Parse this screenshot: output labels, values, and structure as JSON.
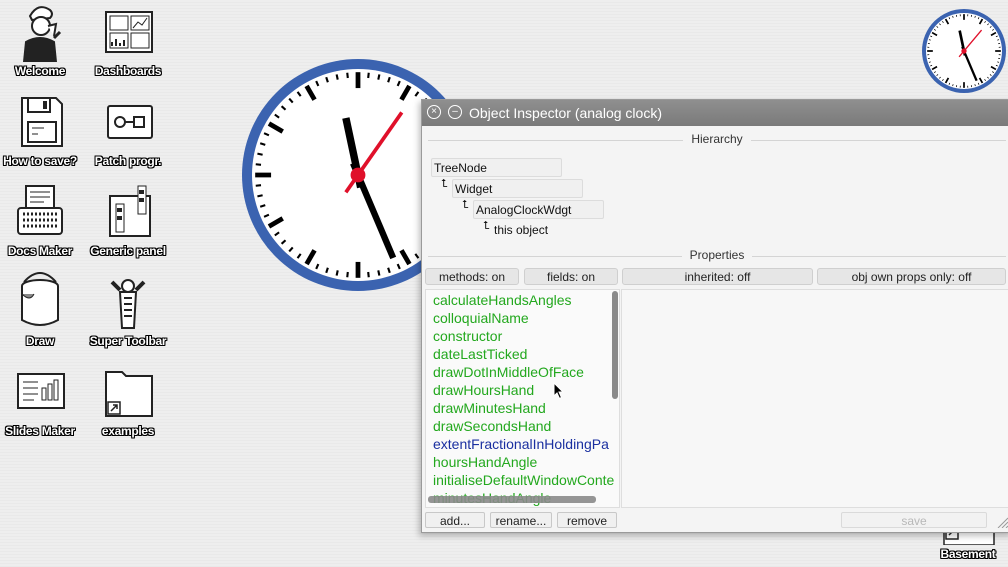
{
  "desktop": {
    "icons": [
      {
        "label": "Welcome"
      },
      {
        "label": "Dashboards"
      },
      {
        "label": "How to save?"
      },
      {
        "label": "Patch progr."
      },
      {
        "label": "Docs Maker"
      },
      {
        "label": "Generic panel"
      },
      {
        "label": "Draw"
      },
      {
        "label": "Super Toolbar"
      },
      {
        "label": "Slides Maker"
      },
      {
        "label": "examples"
      }
    ],
    "basement_label": "Basement"
  },
  "clock": {
    "face_color": "#ffffff",
    "rim_color": "#3b63b0",
    "second_hand_color": "#e0102a",
    "hand_color": "#000000"
  },
  "inspector": {
    "title": "Object Inspector (analog clock)",
    "close_icon": "close-icon",
    "collapse_icon": "collapse-icon",
    "hierarchy_header": "Hierarchy",
    "hierarchy": [
      "TreeNode",
      "Widget",
      "AnalogClockWdgt",
      "this object"
    ],
    "properties_header": "Properties",
    "toggles": {
      "methods": "methods: on",
      "fields": "fields: on",
      "inherited": "inherited: off",
      "own_props": "obj own props only: off"
    },
    "properties": [
      {
        "name": "calculateHandsAngles",
        "inherited": false
      },
      {
        "name": "colloquialName",
        "inherited": false
      },
      {
        "name": "constructor",
        "inherited": false
      },
      {
        "name": "dateLastTicked",
        "inherited": false
      },
      {
        "name": "drawDotInMiddleOfFace",
        "inherited": false
      },
      {
        "name": "drawHoursHand",
        "inherited": false
      },
      {
        "name": "drawMinutesHand",
        "inherited": false
      },
      {
        "name": "drawSecondsHand",
        "inherited": false
      },
      {
        "name": "extentFractionalInHoldingPa",
        "inherited": true
      },
      {
        "name": "hoursHandAngle",
        "inherited": false
      },
      {
        "name": "initialiseDefaultWindowConte",
        "inherited": false
      },
      {
        "name": "minutesHandAngle",
        "inherited": false
      }
    ],
    "buttons": {
      "add": "add...",
      "rename": "rename...",
      "remove": "remove",
      "save": "save"
    }
  }
}
